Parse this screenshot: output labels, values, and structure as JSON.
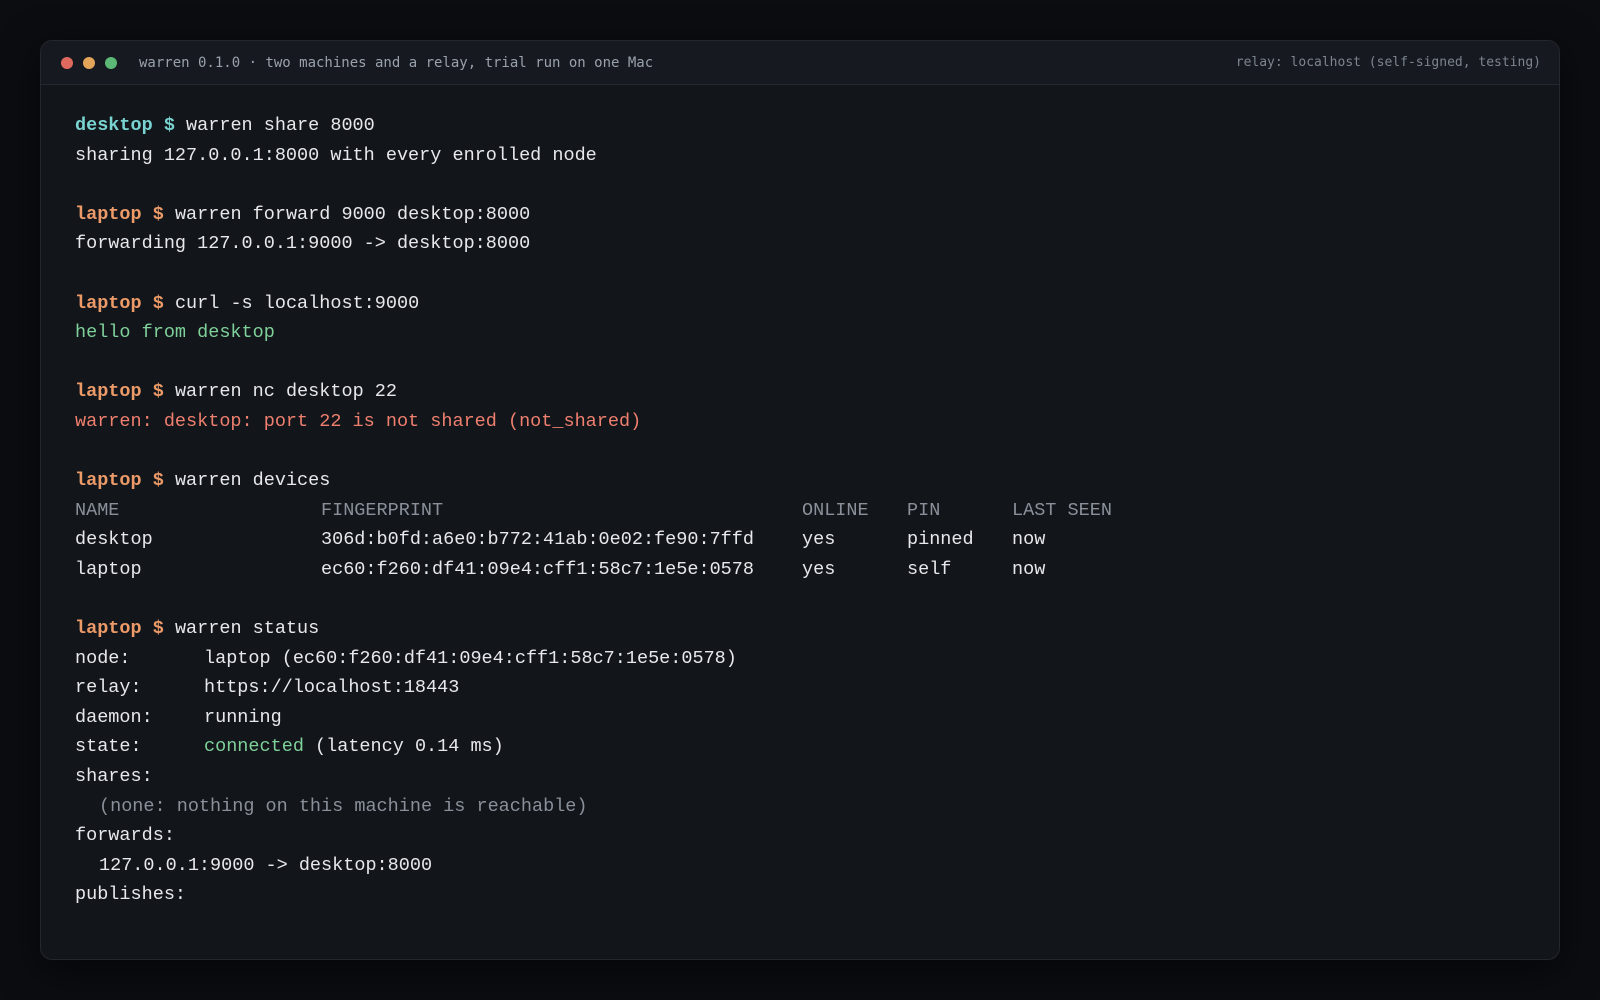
{
  "window": {
    "title": "warren 0.1.0 · two machines and a relay, trial run on one Mac",
    "relay_note": "relay: localhost (self-signed, testing)"
  },
  "prompts": {
    "desktop": "desktop $",
    "laptop": "laptop $"
  },
  "session": {
    "share_cmd": "warren share 8000",
    "share_out": "sharing 127.0.0.1:8000 with every enrolled node",
    "forward_cmd": "warren forward 9000 desktop:8000",
    "forward_out": "forwarding 127.0.0.1:9000 -> desktop:8000",
    "curl_cmd": "curl -s localhost:9000",
    "curl_out": "hello from desktop",
    "nc_cmd": "warren nc desktop 22",
    "nc_out": "warren: desktop: port 22 is not shared (not_shared)",
    "devices_cmd": "warren devices",
    "status_cmd": "warren status"
  },
  "devices": {
    "headers": {
      "name": "NAME",
      "fingerprint": "FINGERPRINT",
      "online": "ONLINE",
      "pin": "PIN",
      "last_seen": "LAST SEEN"
    },
    "rows": [
      {
        "name": "desktop",
        "fingerprint": "306d:b0fd:a6e0:b772:41ab:0e02:fe90:7ffd",
        "online": "yes",
        "pin": "pinned",
        "last_seen": "now"
      },
      {
        "name": "laptop",
        "fingerprint": "ec60:f260:df41:09e4:cff1:58c7:1e5e:0578",
        "online": "yes",
        "pin": "self",
        "last_seen": "now"
      }
    ]
  },
  "status": {
    "node_key": "node:",
    "node_val": "laptop (ec60:f260:df41:09e4:cff1:58c7:1e5e:0578)",
    "relay_key": "relay:",
    "relay_val": "https://localhost:18443",
    "daemon_key": "daemon:",
    "daemon_val": "running",
    "state_key": "state:",
    "state_val": "connected",
    "state_extra": " (latency 0.14 ms)",
    "shares_key": "shares:",
    "shares_val": "(none: nothing on this machine is reachable)",
    "forwards_key": "forwards:",
    "forwards_val": "127.0.0.1:9000 -> desktop:8000",
    "publishes_key": "publishes:"
  },
  "colors": {
    "desktop_prompt": "#79d3d0",
    "laptop_prompt": "#eb9a68",
    "success": "#7fd19a",
    "error": "#ef7f6e",
    "dim": "#8a9099"
  }
}
